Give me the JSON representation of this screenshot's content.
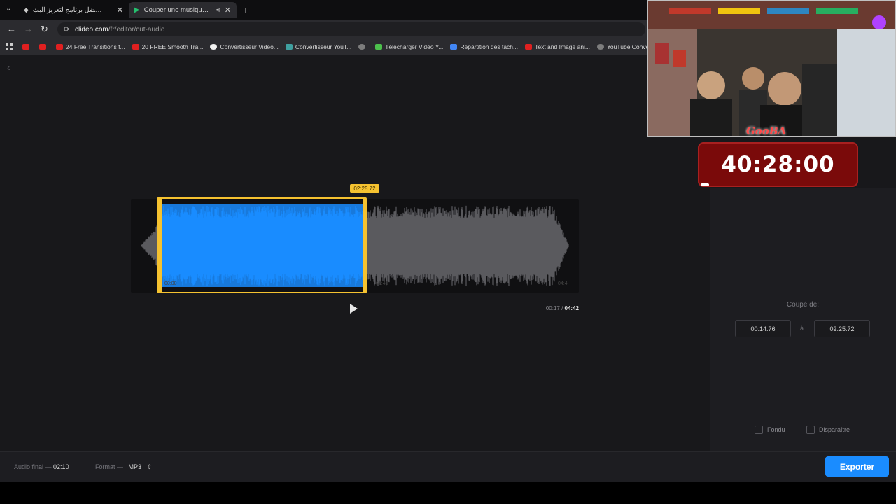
{
  "browser": {
    "tabs": [
      {
        "title": "التنبيهات | أفضل برنامج لتعزيز البث",
        "active": false
      },
      {
        "title": "Couper une musique — Dé",
        "active": true
      }
    ],
    "url_host": "clideo.com",
    "url_path": "/fr/editor/cut-audio",
    "bookmarks": [
      {
        "label": "",
        "icon": "youtube-icon"
      },
      {
        "label": "",
        "icon": "youtube-icon"
      },
      {
        "label": "24 Free Transitions f...",
        "icon": "youtube-icon"
      },
      {
        "label": "20 FREE Smooth Tra...",
        "icon": "youtube-icon"
      },
      {
        "label": "Convertisseur Video...",
        "icon": "google-icon"
      },
      {
        "label": "Convertisseur YouT...",
        "icon": "converter-icon"
      },
      {
        "label": "",
        "icon": "globe-icon"
      },
      {
        "label": "Télécharger Vidéo Y...",
        "icon": "download-icon"
      },
      {
        "label": "Repartition des tach...",
        "icon": "docs-icon"
      },
      {
        "label": "Text and Image ani...",
        "icon": "youtube-icon"
      },
      {
        "label": "YouTube Converter...",
        "icon": "globe-icon"
      }
    ]
  },
  "editor": {
    "selection_end_badge": "02:25.72",
    "current_time": "00:17",
    "total_time": "04:42",
    "waveform_markers": {
      "left": "00:00",
      "mid": "02:40",
      "right": "04:4"
    }
  },
  "panel": {
    "cut_label": "Coupé de:",
    "from_value": "00:14.76",
    "to_label": "à",
    "to_value": "02:25.72",
    "fade_in_label": "Fondu",
    "fade_out_label": "Disparaître"
  },
  "footer": {
    "final_audio_label": "Audio final —",
    "final_audio_value": "02:10",
    "format_label": "Format —",
    "format_value": "MP3",
    "export_label": "Exporter"
  },
  "overlay": {
    "timer": "40:28:00",
    "webcam_logo": "GooBA"
  },
  "colors": {
    "selection": "#1a8cff",
    "handles": "#f5c230",
    "unselected_wave": "#5a5a5e",
    "timer_bg": "#7a0a0a"
  }
}
